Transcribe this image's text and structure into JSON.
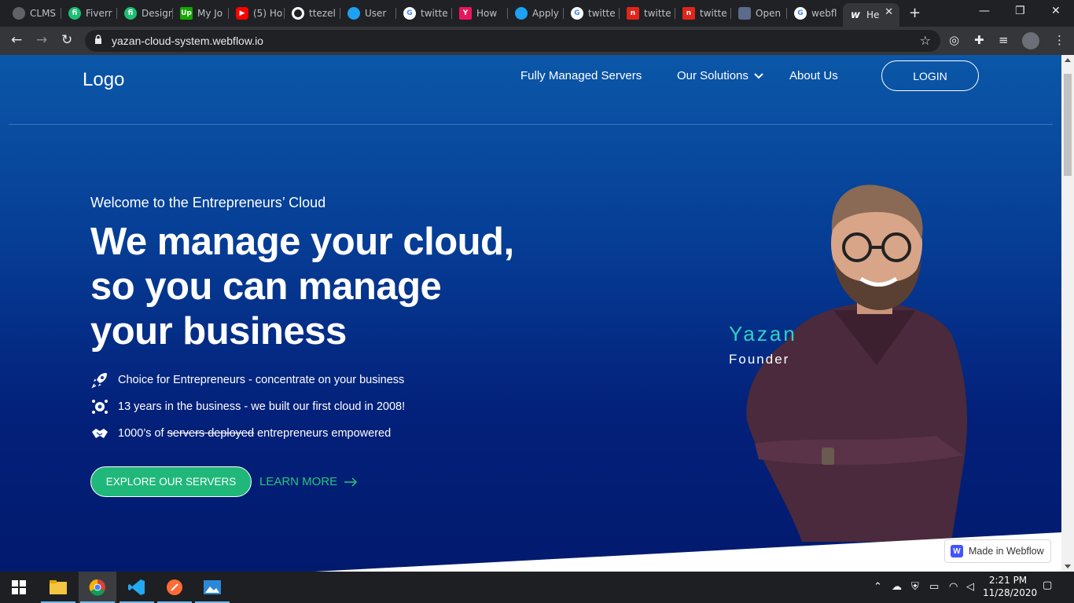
{
  "browser": {
    "tabs": [
      {
        "label": "CLMS",
        "color": "#5f6368",
        "glyph": ""
      },
      {
        "label": "Fiverr",
        "color": "#1dbf73",
        "glyph": "fi"
      },
      {
        "label": "Design",
        "color": "#1dbf73",
        "glyph": "fi"
      },
      {
        "label": "My Jo",
        "color": "#14a800",
        "glyph": "Up"
      },
      {
        "label": "(5) Ho",
        "color": "#ff0000",
        "glyph": "▶"
      },
      {
        "label": "ttezel",
        "color": "#24292e",
        "glyph": ""
      },
      {
        "label": "User",
        "color": "#1da1f2",
        "glyph": ""
      },
      {
        "label": "twitte",
        "color": "#ffffff",
        "glyph": "G"
      },
      {
        "label": "How",
        "color": "#e8175d",
        "glyph": "Y"
      },
      {
        "label": "Apply",
        "color": "#1da1f2",
        "glyph": ""
      },
      {
        "label": "twitte",
        "color": "#ffffff",
        "glyph": "G"
      },
      {
        "label": "twitte",
        "color": "#e1251b",
        "glyph": "n"
      },
      {
        "label": "twitte",
        "color": "#e1251b",
        "glyph": "n"
      },
      {
        "label": "Open",
        "color": "#5a6b8c",
        "glyph": ""
      },
      {
        "label": "webfl",
        "color": "#ffffff",
        "glyph": "G"
      },
      {
        "label": "He",
        "color": "#35363a",
        "glyph": "w",
        "active": true
      }
    ],
    "url": "yazan-cloud-system.webflow.io"
  },
  "site": {
    "logo": "Logo",
    "nav": {
      "servers": "Fully Managed Servers",
      "solutions": "Our Solutions",
      "about": "About Us",
      "login": "LOGIN"
    },
    "hero": {
      "welcome": "Welcome to the Entrepreneurs’ Cloud",
      "headline_1": "We manage your cloud,",
      "headline_2": "so you can manage",
      "headline_3": "your business",
      "features": [
        {
          "icon": "rocket-icon",
          "text": "Choice for Entrepreneurs - concentrate on your business"
        },
        {
          "icon": "gear-people-icon",
          "text": "13 years in the business - we built our first cloud in 2008!"
        },
        {
          "icon": "handshake-icon",
          "pre": "1000’s of ",
          "strike": "servers deployed",
          "post": " entrepreneurs empowered"
        }
      ],
      "explore_button": "EXPLORE OUR SERVERS",
      "learn_more": "LEARN MORE"
    },
    "founder": {
      "name": "Yazan",
      "role": "Founder"
    },
    "badge": "Made in Webflow"
  },
  "taskbar": {
    "time": "2:21 PM",
    "date": "11/28/2020"
  },
  "colors": {
    "accent_green": "#20b87a",
    "founder_name": "#34d0c4",
    "hero_top": "#0b57a8",
    "hero_bottom": "#021a6e"
  }
}
